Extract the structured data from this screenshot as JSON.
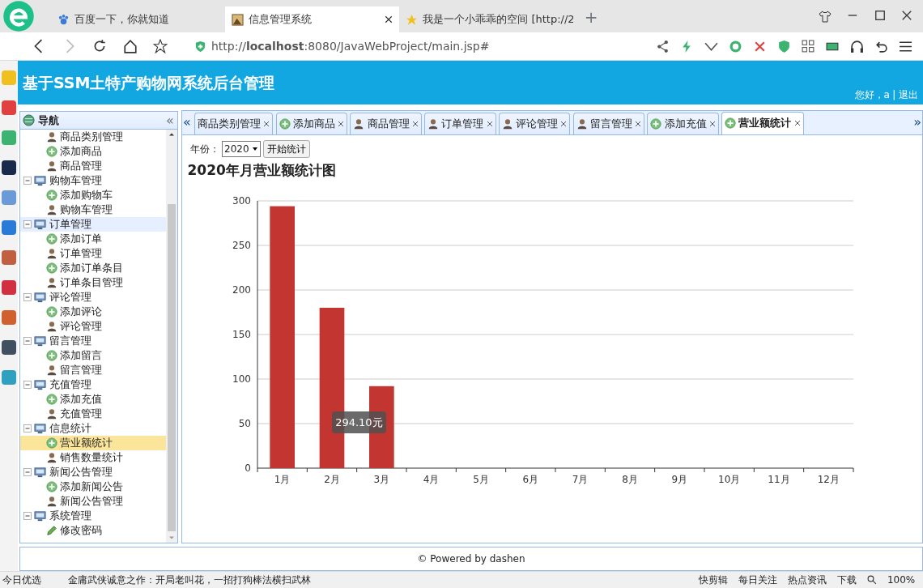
{
  "browser": {
    "tabs": [
      {
        "title": "百度一下，你就知道",
        "selected": false
      },
      {
        "title": "信息管理系统",
        "selected": true
      },
      {
        "title": "我是一个小乖乖的空间 [http://2",
        "selected": false
      }
    ],
    "new_tab": "+",
    "url": "http://**localhost**:8080/JavaWebProject/main.jsp#"
  },
  "header": {
    "title": "基于SSM土特产购物网系统后台管理",
    "greeting": "您好，a",
    "separator": "|",
    "logout": "退出"
  },
  "nav": {
    "title": "导航",
    "collapse": "«",
    "groups": [
      {
        "children": [
          {
            "label": "商品类别管理",
            "kind": "person",
            "selected": false
          },
          {
            "label": "添加商品",
            "kind": "add",
            "selected": false
          },
          {
            "label": "商品管理",
            "kind": "person",
            "selected": false
          }
        ]
      },
      {
        "label": "购物车管理",
        "expanded": true,
        "children": [
          {
            "label": "添加购物车",
            "kind": "add",
            "selected": false
          },
          {
            "label": "购物车管理",
            "kind": "person",
            "selected": false
          }
        ]
      },
      {
        "label": "订单管理",
        "expanded": true,
        "hovered": true,
        "children": [
          {
            "label": "添加订单",
            "kind": "add",
            "selected": false
          },
          {
            "label": "订单管理",
            "kind": "person",
            "selected": false
          },
          {
            "label": "添加订单条目",
            "kind": "add",
            "selected": false
          },
          {
            "label": "订单条目管理",
            "kind": "person",
            "selected": false
          }
        ]
      },
      {
        "label": "评论管理",
        "expanded": true,
        "children": [
          {
            "label": "添加评论",
            "kind": "add",
            "selected": false
          },
          {
            "label": "评论管理",
            "kind": "person",
            "selected": false
          }
        ]
      },
      {
        "label": "留言管理",
        "expanded": true,
        "children": [
          {
            "label": "添加留言",
            "kind": "add",
            "selected": false
          },
          {
            "label": "留言管理",
            "kind": "person",
            "selected": false
          }
        ]
      },
      {
        "label": "充值管理",
        "expanded": true,
        "children": [
          {
            "label": "添加充值",
            "kind": "add",
            "selected": false
          },
          {
            "label": "充值管理",
            "kind": "person",
            "selected": false
          }
        ]
      },
      {
        "label": "信息统计",
        "expanded": true,
        "children": [
          {
            "label": "营业额统计",
            "kind": "add",
            "selected": true
          },
          {
            "label": "销售数量统计",
            "kind": "person",
            "selected": false
          }
        ]
      },
      {
        "label": "新闻公告管理",
        "expanded": true,
        "children": [
          {
            "label": "添加新闻公告",
            "kind": "add",
            "selected": false
          },
          {
            "label": "新闻公告管理",
            "kind": "person",
            "selected": false
          }
        ]
      },
      {
        "label": "系统管理",
        "expanded": true,
        "children": [
          {
            "label": "修改密码",
            "kind": "pencil",
            "selected": false
          }
        ]
      }
    ]
  },
  "tabs": {
    "prev": "«",
    "next": "»",
    "items": [
      {
        "label": "商品类别管理",
        "kind": "none",
        "selected": false
      },
      {
        "label": "添加商品",
        "kind": "add",
        "selected": false
      },
      {
        "label": "商品管理",
        "kind": "person",
        "selected": false
      },
      {
        "label": "订单管理",
        "kind": "person",
        "selected": false
      },
      {
        "label": "评论管理",
        "kind": "person",
        "selected": false
      },
      {
        "label": "留言管理",
        "kind": "person",
        "selected": false
      },
      {
        "label": "添加充值",
        "kind": "add",
        "selected": false
      },
      {
        "label": "营业额统计",
        "kind": "add",
        "selected": true
      }
    ]
  },
  "stats": {
    "year_label": "年份：",
    "year": "2020",
    "start_button": "开始统计",
    "title": "2020年月营业额统计图",
    "tooltip": "294.10元",
    "chart_data": {
      "type": "bar",
      "categories": [
        "1月",
        "2月",
        "3月",
        "4月",
        "5月",
        "6月",
        "7月",
        "8月",
        "9月",
        "10月",
        "11月",
        "12月"
      ],
      "series": [
        {
          "color": "#c23531",
          "values": [
            294,
            180,
            92,
            0,
            0,
            0,
            0,
            0,
            0,
            0,
            0,
            0
          ]
        }
      ],
      "grid": true,
      "ylim": [
        0,
        300
      ],
      "yticks": [
        0,
        50,
        100,
        150,
        200,
        250,
        300
      ]
    }
  },
  "footer": "© Powered by dashen",
  "status_bar": {
    "left": "今日优选",
    "news": "金庸武侠诚意之作：开局老叫花，一招打狗棒法横扫武林",
    "items": [
      "快剪辑",
      "每日关注",
      "热点资讯",
      "下载"
    ],
    "zoom": "100%"
  }
}
